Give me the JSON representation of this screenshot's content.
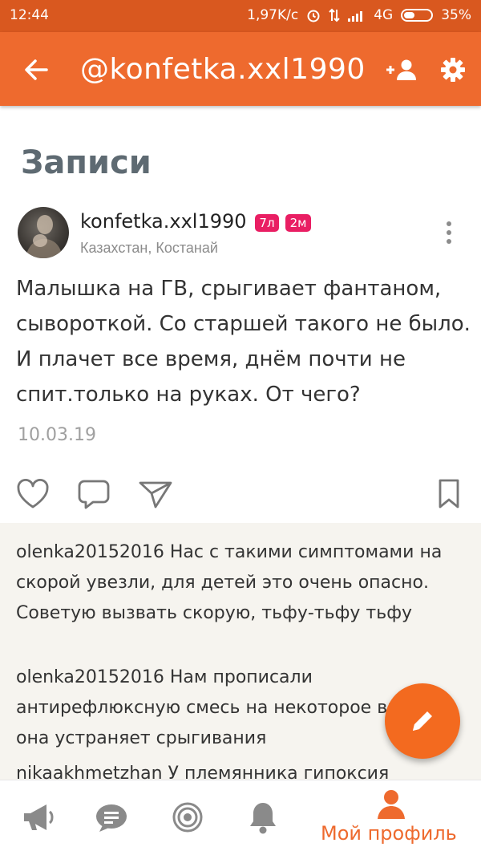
{
  "status_bar": {
    "time": "12:44",
    "speed": "1,97K/c",
    "network": "4G",
    "battery": "35%"
  },
  "app_bar": {
    "title": "@konfetka.xxl1990",
    "back_icon": "arrow-left-icon",
    "add_user_icon": "add-user-icon",
    "settings_icon": "gear-icon"
  },
  "section": {
    "title": "Записи"
  },
  "post": {
    "author": "konfetka.xxl1990",
    "badges": [
      "7л",
      "2м"
    ],
    "location": "Казахстан, Костанай",
    "text": "Малышка на ГВ, срыгивает фантаном, сывороткой. Со старшей такого не было. И плачет все время, днём почти не спит.только на руках. От чего?",
    "date": "10.03.19",
    "actions": [
      "heart-icon",
      "comment-icon",
      "share-icon",
      "bookmark-icon"
    ]
  },
  "comments": [
    {
      "text": "olenka20152016 Нас с такими симптомами на скорой увезли, для детей это очень опасно. Советую вызвать скорую, тьфу-тьфу тьфу"
    },
    {
      "text": "olenka20152016 Нам прописали антирефлюксную смесь на некоторое время, она устраняет срыгивания"
    },
    {
      "text": "nikaakhmetzhan У племянника гипоксия"
    }
  ],
  "fab_icon": "pencil-icon",
  "bottom_nav": {
    "items": [
      "megaphone-icon",
      "chat-icon",
      "target-icon",
      "bell-icon",
      "profile-icon"
    ],
    "active_label": "Мой профиль"
  },
  "colors": {
    "accent": "#ee6a2e",
    "badge": "#e91e63",
    "comments_bg": "#f6f4ef"
  }
}
